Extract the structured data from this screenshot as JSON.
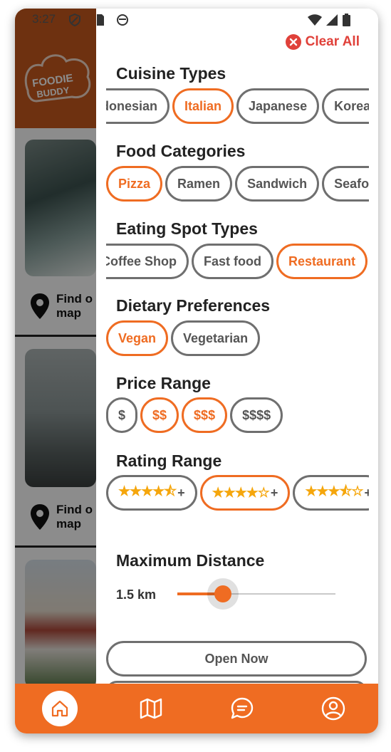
{
  "status_bar": {
    "time": "3:27"
  },
  "background_app": {
    "logo_text": [
      "FOODIE",
      "BUDDY"
    ],
    "find_on_map_label": "Find on map",
    "find_on_map_line1": "Find o",
    "find_on_map_line2": "map"
  },
  "filters": {
    "clear_all_label": "Clear All",
    "cuisine": {
      "title": "Cuisine Types",
      "options": [
        "Indonesian",
        "Italian",
        "Japanese",
        "Korean"
      ],
      "selected": [
        "Italian"
      ]
    },
    "food_categories": {
      "title": "Food Categories",
      "options": [
        "Pizza",
        "Ramen",
        "Sandwich",
        "Seafood"
      ],
      "selected": [
        "Pizza"
      ]
    },
    "eating_spot_types": {
      "title": "Eating Spot Types",
      "options": [
        "Coffee Shop",
        "Fast food",
        "Restaurant"
      ],
      "selected": [
        "Restaurant"
      ]
    },
    "dietary": {
      "title": "Dietary Preferences",
      "options": [
        "Vegan",
        "Vegetarian"
      ],
      "selected": [
        "Vegan"
      ]
    },
    "price": {
      "title": "Price Range",
      "options": [
        "$",
        "$$",
        "$$$",
        "$$$$"
      ],
      "selected": [
        "$$",
        "$$$"
      ]
    },
    "rating": {
      "title": "Rating Range",
      "options": [
        "4.5+",
        "4+",
        "3.5+"
      ],
      "selected": [
        "4+"
      ]
    },
    "distance": {
      "title": "Maximum Distance",
      "value_label": "1.5 km",
      "slider_fraction": 0.29
    },
    "open_now_label": "Open Now"
  },
  "bottom_nav": {
    "items": [
      {
        "name": "home",
        "icon": "home-icon",
        "active": true
      },
      {
        "name": "map",
        "icon": "map-icon",
        "active": false
      },
      {
        "name": "chat",
        "icon": "chat-icon",
        "active": false
      },
      {
        "name": "profile",
        "icon": "profile-icon",
        "active": false
      }
    ]
  },
  "colors": {
    "accent": "#ef6c22",
    "danger": "#e0413a",
    "chip_border": "#6f6f6f",
    "star": "#f5a60c"
  }
}
